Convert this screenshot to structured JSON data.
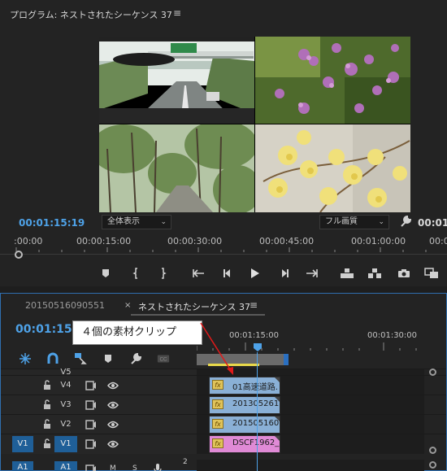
{
  "program": {
    "title": "プログラム: ネストされたシーケンス 37",
    "menu_icon": "≡",
    "current_timecode": "00:01:15:19",
    "duration_timecode": "00:01",
    "zoom_select": "全体表示",
    "quality_select": "フル画質",
    "ruler_labels": [
      ":00:00",
      "00:00:15:00",
      "00:00:30:00",
      "00:00:45:00",
      "00:01:00:00",
      "00:01"
    ]
  },
  "timeline": {
    "tab_source": "20150516090551",
    "tab_close": "×",
    "tab_sequence": "ネストされたシーケンス 37",
    "tab_menu": "≡",
    "timecode": "00:01:15:",
    "ruler_labels": [
      "00:01:15:00",
      "00:01:30:00"
    ],
    "callout": "４個の素材クリップ",
    "tracks": [
      {
        "label": "V5",
        "clip": null
      },
      {
        "label": "V4",
        "clip": {
          "name": "01高速道路.",
          "fx": "fx"
        }
      },
      {
        "label": "V3",
        "clip": {
          "name": "201305261",
          "fx": "fx"
        }
      },
      {
        "label": "V2",
        "clip": {
          "name": "201505160",
          "fx": "fx"
        }
      },
      {
        "label": "V1",
        "source": "V1",
        "clip": {
          "name": "DSCF1962_",
          "fx": "fx"
        }
      }
    ],
    "audio_row": {
      "source": "A1",
      "label": "A1",
      "m": "M",
      "s": "S",
      "num": "2"
    }
  },
  "colors": {
    "accent_blue": "#4ea2e8",
    "clip_blue": "#8ab0d6",
    "clip_pink": "#e08ad6",
    "work_area_yellow": "#e8d84a"
  }
}
